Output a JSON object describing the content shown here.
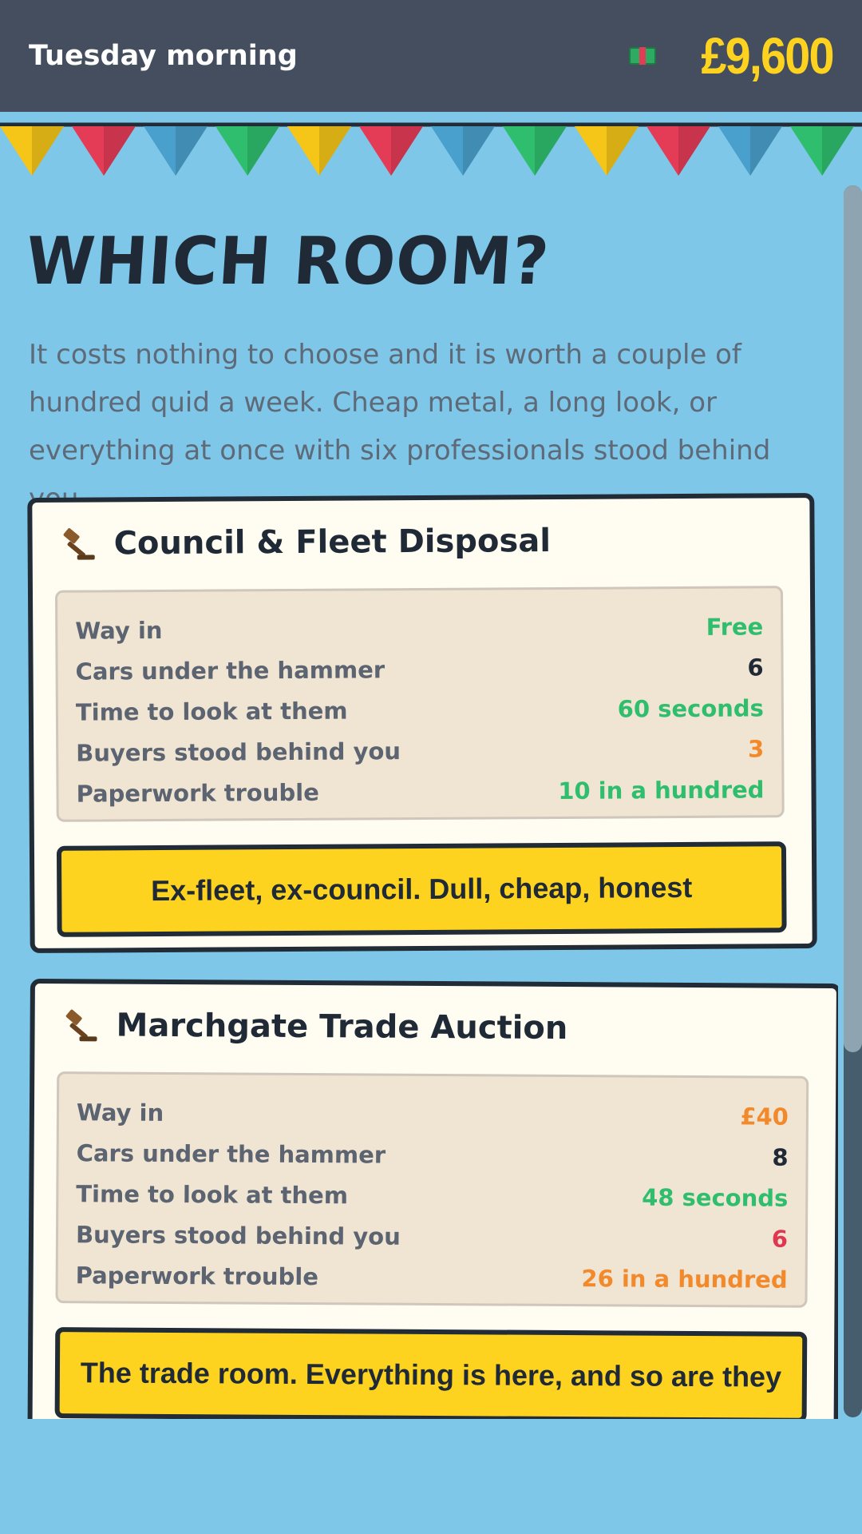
{
  "header": {
    "time_of_day": "Tuesday morning",
    "money": "£9,600",
    "cash_icon": "cash-icon"
  },
  "bunting_colors": [
    "#f5c518",
    "#e43c56",
    "#4aa0cc",
    "#2fbe6e"
  ],
  "page": {
    "title": "WHICH ROOM?",
    "intro": "It costs nothing to choose and it is worth a couple of hundred quid a week. Cheap metal, a long look, or everything at once with six professionals stood behind you."
  },
  "rooms": [
    {
      "name": "Council & Fleet Disposal",
      "icon": "gavel-icon",
      "stats": [
        {
          "label": "Way in",
          "value": "Free",
          "tone": "green"
        },
        {
          "label": "Cars under the hammer",
          "value": "6",
          "tone": "dark"
        },
        {
          "label": "Time to look at them",
          "value": "60 seconds",
          "tone": "green"
        },
        {
          "label": "Buyers stood behind you",
          "value": "3",
          "tone": "orange"
        },
        {
          "label": "Paperwork trouble",
          "value": "10 in a hundred",
          "tone": "green"
        }
      ],
      "choose_label": "Ex-fleet, ex-council. Dull, cheap, honest"
    },
    {
      "name": "Marchgate Trade Auction",
      "icon": "gavel-icon",
      "stats": [
        {
          "label": "Way in",
          "value": "£40",
          "tone": "orange"
        },
        {
          "label": "Cars under the hammer",
          "value": "8",
          "tone": "dark"
        },
        {
          "label": "Time to look at them",
          "value": "48 seconds",
          "tone": "green"
        },
        {
          "label": "Buyers stood behind you",
          "value": "6",
          "tone": "red"
        },
        {
          "label": "Paperwork trouble",
          "value": "26 in a hundred",
          "tone": "orange"
        }
      ],
      "choose_label": "The trade room. Everything is here, and so are they"
    }
  ],
  "colors": {
    "background": "#7ec7e8",
    "header": "#444e5e",
    "money": "#fdd31f",
    "button": "#fdd31f",
    "card": "#fffcf1",
    "good": "#2fbe6e",
    "warn": "#f28a2c",
    "bad": "#e0364f"
  }
}
